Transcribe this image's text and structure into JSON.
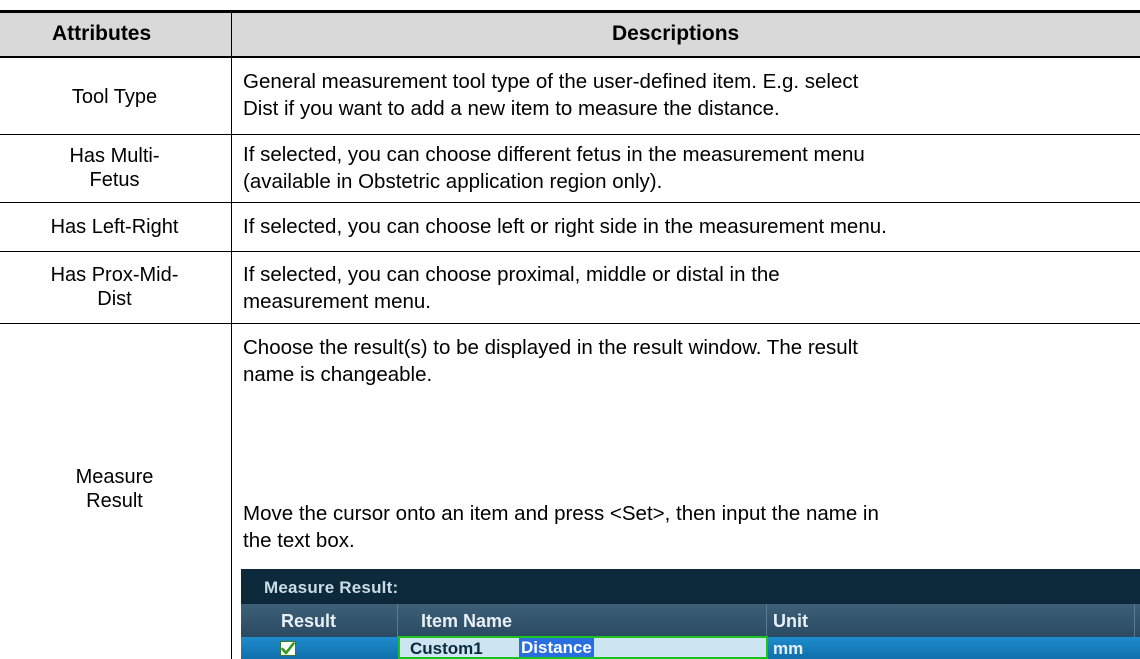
{
  "table": {
    "headers": {
      "attributes": "Attributes",
      "descriptions": "Descriptions"
    },
    "rows": [
      {
        "attribute": [
          "Tool Type"
        ],
        "description": [
          "General measurement tool type of the user-defined item. E.g. select",
          "Dist if you want to add a new item to measure the distance."
        ]
      },
      {
        "attribute": [
          "Has Multi-",
          "Fetus"
        ],
        "description": [
          "If selected, you can choose different fetus in the measurement menu",
          "(available in Obstetric application region only)."
        ]
      },
      {
        "attribute": [
          "Has Left-Right"
        ],
        "description": [
          "If selected, you can choose left or right side in the measurement menu."
        ]
      },
      {
        "attribute": [
          "Has Prox-Mid-",
          "Dist"
        ],
        "description": [
          "If selected, you can choose proximal, middle or distal in the",
          "measurement menu."
        ]
      },
      {
        "attribute": [
          "Measure",
          "Result"
        ],
        "description": [
          "Choose the result(s) to be displayed in the result window. The result",
          "name is changeable.",
          "Move the cursor onto an item and press <Set>, then input the name in",
          "the text box."
        ]
      }
    ]
  },
  "measure_ui": {
    "title": "Measure Result:",
    "columns": [
      "Result",
      "Item Name",
      "Unit"
    ],
    "row": {
      "checked": true,
      "name_prefix": "Custom1",
      "name_selected": "Distance",
      "unit": "mm"
    },
    "colors": {
      "panel_bg": "#0c2a3b",
      "header_bg": "#2f5069",
      "row_bg": "#1280c0",
      "edit_border": "#1ec21e",
      "selection": "#2a6fe0"
    }
  }
}
